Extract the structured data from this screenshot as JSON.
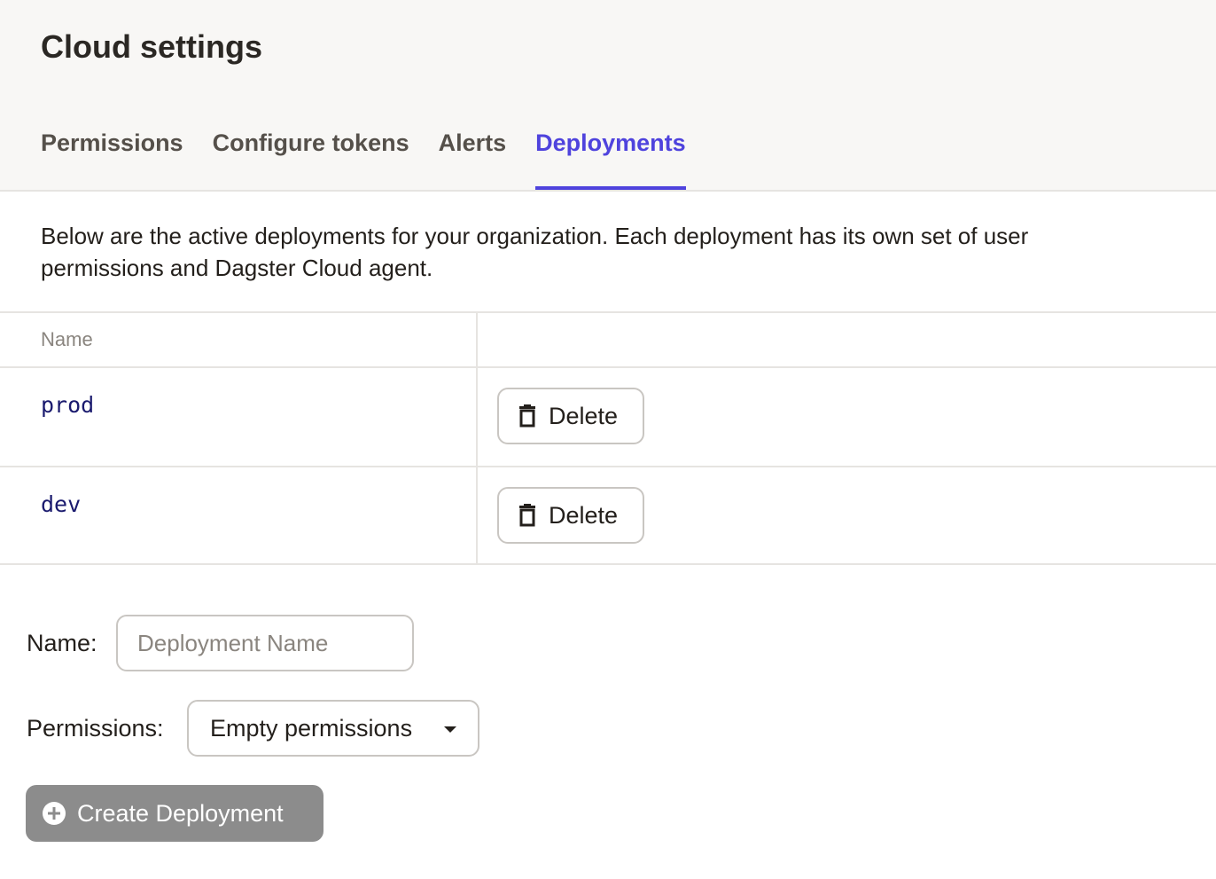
{
  "header": {
    "title": "Cloud settings",
    "tabs": [
      {
        "label": "Permissions"
      },
      {
        "label": "Configure tokens"
      },
      {
        "label": "Alerts"
      },
      {
        "label": "Deployments",
        "active": true
      }
    ]
  },
  "description": "Below are the active deployments for your organization. Each deployment has its own set of user permissions and Dagster Cloud agent.",
  "table": {
    "columns": [
      "Name",
      ""
    ],
    "rows": [
      {
        "name": "prod",
        "action_label": "Delete",
        "action_icon": "trash-icon"
      },
      {
        "name": "dev",
        "action_label": "Delete",
        "action_icon": "trash-icon"
      }
    ]
  },
  "form": {
    "name_label": "Name:",
    "name_placeholder": "Deployment Name",
    "name_value": "",
    "permissions_label": "Permissions:",
    "permissions_value": "Empty permissions",
    "create_label": "Create Deployment",
    "create_icon": "add-circle-icon"
  },
  "colors": {
    "accent": "#4f43dd",
    "header_bg": "#f8f7f5",
    "disabled_button": "#8c8c8c",
    "code_text": "#1a1a6e"
  }
}
